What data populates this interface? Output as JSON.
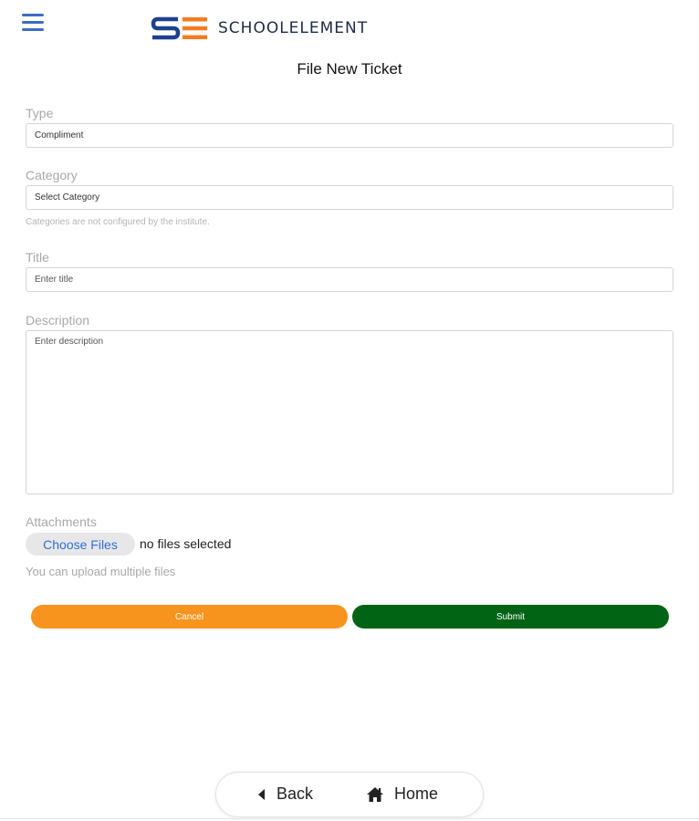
{
  "header": {
    "menu_icon": "hamburger-menu-icon",
    "brand_name": "SCHOOLELEMENT",
    "colors": {
      "brand_blue": "#1f3f8f",
      "brand_orange": "#f47c20"
    }
  },
  "page_title": "File New Ticket",
  "form": {
    "type": {
      "label": "Type",
      "value": "Compliment"
    },
    "category": {
      "label": "Category",
      "value": "Select Category",
      "help": "Categories are not configured by the institute."
    },
    "title": {
      "label": "Title",
      "placeholder": "Enter title"
    },
    "description": {
      "label": "Description",
      "placeholder": "Enter description"
    },
    "attachments": {
      "label": "Attachments",
      "choose_button": "Choose Files",
      "status": "no files selected",
      "hint": "You can upload multiple files"
    },
    "buttons": {
      "cancel": "Cancel",
      "submit": "Submit",
      "colors": {
        "cancel": "#f7941d",
        "submit": "#006414"
      }
    }
  },
  "bottom_nav": {
    "back": {
      "label": "Back",
      "icon": "caret-left-icon"
    },
    "home": {
      "label": "Home",
      "icon": "home-icon"
    }
  }
}
